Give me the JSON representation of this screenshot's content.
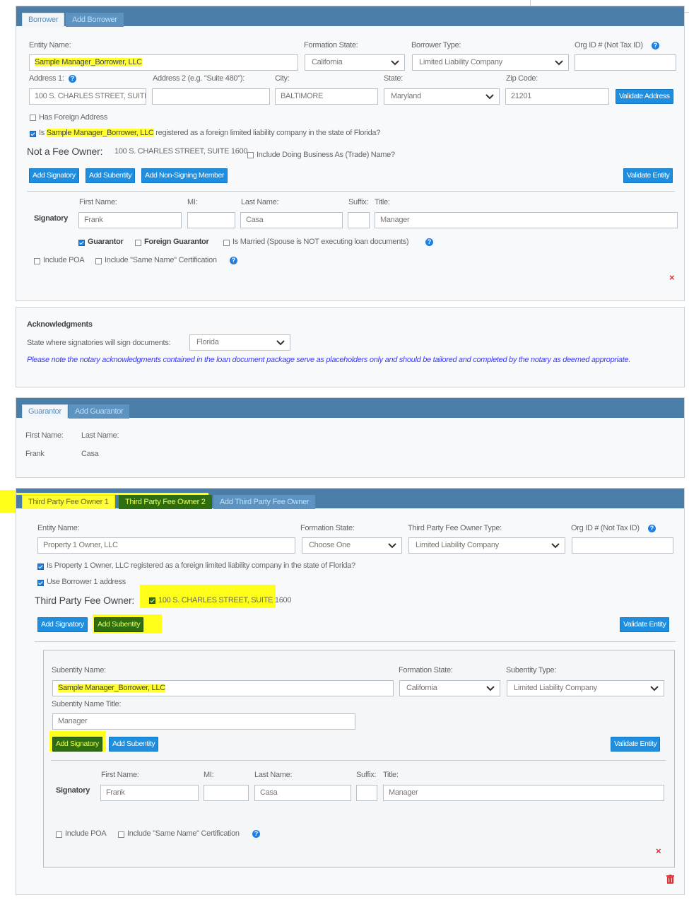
{
  "borrower": {
    "tabs": [
      "Borrower",
      "Add Borrower"
    ],
    "entity_name_label": "Entity Name:",
    "entity_name_value": "Sample Manager_Borrower, LLC",
    "formation_state_label": "Formation State:",
    "formation_state_value": "California",
    "borrower_type_label": "Borrower Type:",
    "borrower_type_value": "Limited Liability Company",
    "org_id_label": "Org ID # (Not Tax ID)",
    "org_id_value": "",
    "address1_label": "Address 1:",
    "address1_value": "100 S. CHARLES STREET, SUITI",
    "address2_label": "Address 2 (e.g. \"Suite 480\"):",
    "address2_value": "",
    "city_label": "City:",
    "city_value": "BALTIMORE",
    "state_label": "State:",
    "state_value": "Maryland",
    "zip_label": "Zip Code:",
    "zip_value": "21201",
    "validate_address": "Validate Address",
    "has_foreign_address": "Has Foreign Address",
    "foreign_q_prefix": "Is",
    "foreign_q_name": "Sample Manager_Borrower, LLC",
    "foreign_q_suffix": "registered as a foreign limited liability company in the state of Florida?",
    "fee_owner_label": "Not a Fee Owner:",
    "fee_owner_address": "100 S. CHARLES STREET, SUITE 1600",
    "include_dba": "Include Doing Business As (Trade) Name?",
    "add_signatory": "Add Signatory",
    "add_subentity": "Add Subentity",
    "add_non_signing": "Add Non-Signing Member",
    "validate_entity": "Validate Entity",
    "signatory": {
      "row_label": "Signatory",
      "first_name_label": "First Name:",
      "first_name": "Frank",
      "mi_label": "MI:",
      "mi": "",
      "last_name_label": "Last Name:",
      "last_name": "Casa",
      "suffix_label": "Suffix:",
      "suffix": "",
      "title_label": "Title:",
      "title": "Manager",
      "guarantor": "Guarantor",
      "foreign_guarantor": "Foreign Guarantor",
      "is_married": "Is Married (Spouse is NOT executing loan documents)",
      "include_poa": "Include POA",
      "same_name_cert": "Include \"Same Name\" Certification"
    }
  },
  "acknowledgments": {
    "title": "Acknowledgments",
    "state_label": "State where signatories will sign documents:",
    "state_value": "Florida",
    "note": "Please note the notary acknowledgments contained in the loan document package serve as placeholders only and should be tailored and completed by the notary as deemed appropriate."
  },
  "guarantor": {
    "tabs": [
      "Guarantor",
      "Add Guarantor"
    ],
    "first_name_label": "First Name:",
    "last_name_label": "Last Name:",
    "first_name": "Frank",
    "last_name": "Casa"
  },
  "third_party": {
    "tabs": [
      "Third Party Fee Owner 1",
      "Third Party Fee Owner 2",
      "Add Third Party Fee Owner"
    ],
    "entity_name_label": "Entity Name:",
    "entity_name_value": "Property 1 Owner, LLC",
    "formation_state_label": "Formation State:",
    "formation_state_value": "Choose One",
    "type_label": "Third Party Fee Owner Type:",
    "type_value": "Limited Liability Company",
    "org_id_label": "Org ID # (Not Tax ID)",
    "org_id_value": "",
    "foreign_q": "Is Property 1 Owner, LLC registered as a foreign limited liability company in the state of Florida?",
    "use_borrower_address": "Use Borrower 1 address",
    "fee_owner_label": "Third Party Fee Owner:",
    "fee_owner_address": "100 S. CHARLES STREET, SUITE 1600",
    "add_signatory": "Add Signatory",
    "add_subentity": "Add Subentity",
    "validate_entity": "Validate Entity",
    "subentity": {
      "name_label": "Subentity Name:",
      "name_value": "Sample Manager_Borrower, LLC",
      "formation_state_label": "Formation State:",
      "formation_state_value": "California",
      "type_label": "Subentity Type:",
      "type_value": "Limited Liability Company",
      "title_label": "Subentity Name Title:",
      "title_value": "Manager",
      "add_signatory": "Add Signatory",
      "add_subentity": "Add Subentity",
      "validate_entity": "Validate Entity",
      "signatory": {
        "row_label": "Signatory",
        "first_name_label": "First Name:",
        "first_name": "Frank",
        "mi_label": "MI:",
        "mi": "",
        "last_name_label": "Last Name:",
        "last_name": "Casa",
        "suffix_label": "Suffix:",
        "suffix": "",
        "title_label": "Title:",
        "title": "Manager",
        "include_poa": "Include POA",
        "same_name_cert": "Include \"Same Name\" Certification"
      }
    }
  }
}
